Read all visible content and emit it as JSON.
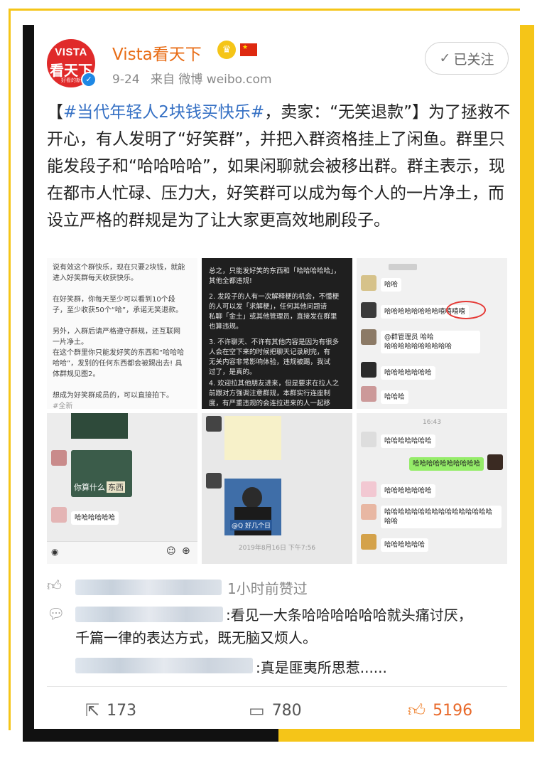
{
  "post": {
    "author": "Vista看天下",
    "avatar_logo_top": "VISTA",
    "avatar_logo_mid": "看天下",
    "avatar_logo_bot": "好看的新",
    "date": "9-24",
    "source": "来自 微博 weibo.com",
    "follow_label": "已关注",
    "text_open": "【",
    "topic": "#当代年轻人2块钱买快乐#",
    "text_body": "，卖家：“无笑退款”】为了拯救不开心，有人发明了“好笑群”，并把入群资格挂上了闲鱼。群里只能发段子和“哈哈哈哈”，如果闲聊就会被移出群。群主表示，现在都市人忙碌、压力大，好笑群可以成为每个人的一片净土，而设立严格的群规是为了让大家更高效地刷段子。"
  },
  "images": {
    "t1_lines": [
      "说有效这个群快乐，现在只要2块钱，就能",
      "进入好笑群每天收获快乐。",
      "",
      "在好笑群，你每天至少可以看到10个段",
      "子，至少收获50个“哈”，承诺无笑退款。",
      "",
      "另外，入群后请严格遵守群规，还互联网",
      "一片净土。",
      "在这个群里你只能发好笑的东西和“哈哈哈",
      "哈哈”，发别的任何东西都会被踢出去! 具",
      "体群规见图2。",
      "",
      "想成为好笑群成员的，可以直接拍下。",
      "#全新"
    ],
    "t2_lines": [
      "总之，只能发好笑的东西和「哈哈哈哈哈」，",
      "其他全都违规!",
      "",
      "2. 发段子的人有一次解释梗的机会，不懂梗",
      "的人可以发「求解梗」，任何其他问题请",
      "私聊「金土」或其他管理员，直接发在群里",
      "也算违规。",
      "",
      "3. 不许聊天、不许有其他内容是因为有很多",
      "人会在空下来的时候把聊天记录刷完，有",
      "无关内容非常影响体验，违规被踢，我试",
      "过了，是真的。",
      "",
      "4. 欢迎拉其他朋友进来，但是要求在拉人之",
      "前跟对方强调注意群规，本群实行连座制",
      "度，有严重违规的会连拉进来的人一起移"
    ],
    "t3": {
      "msg1": "哈哈",
      "msg2": "哈哈哈哈哈哈哈哈",
      "msg2_circled": "嘻嘻嘻嘻",
      "msg3_a": "@群管理员",
      "msg3_b": "哈哈",
      "msg3_c": "哈哈哈哈哈哈哈哈哈哈",
      "msg4": "哈哈哈哈哈哈哈",
      "msg5": "哈哈哈"
    },
    "t4": {
      "caption": "你算什么",
      "caption2": "东西",
      "msg": "哈哈哈哈哈哈"
    },
    "t5": {
      "badge": "@Q 好几个日",
      "timestamp": "2019年8月16日 下午7:56"
    },
    "t6": {
      "time": "16:43",
      "msg1": "哈哈哈哈哈哈哈",
      "msg2": "哈哈哈哈哈哈哈哈哈哈",
      "msg3": "哈哈哈哈哈哈哈哈哈哈哈哈哈哈哈哈哈哈",
      "msg4": "哈哈哈哈哈哈"
    }
  },
  "comments": {
    "like_suffix": "1小时前赞过",
    "comment1": ":看见一大条哈哈哈哈哈哈就头痛讨厌，千篇一律的表达方式，既无脑又烦人。",
    "comment1_line1": ":看见一大条哈哈哈哈哈哈就头痛讨厌，",
    "comment1_line2": "千篇一律的表达方式，既无脑又烦人。",
    "comment2": ":真是匪夷所思惹......"
  },
  "actions": {
    "repost_count": "173",
    "comment_count": "780",
    "like_count": "5196"
  },
  "colors": {
    "accent_orange": "#e86c15",
    "topic_blue": "#3570c4",
    "frame_yellow": "#f5c518",
    "frame_black": "#111111"
  },
  "icons": [
    "crown-icon",
    "flag-icon",
    "check-icon",
    "verified-icon",
    "thumb-icon",
    "comment-icon",
    "repost-icon",
    "like-icon"
  ]
}
